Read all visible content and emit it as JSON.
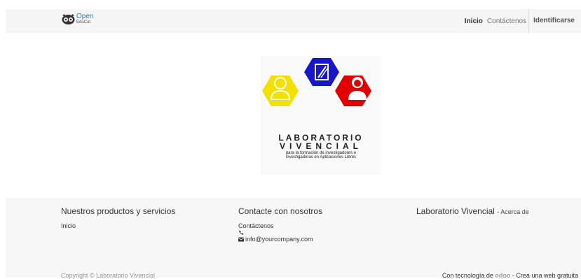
{
  "navbar": {
    "brand_line1": "Open",
    "brand_line2": "EduCat",
    "items": [
      "Inicio",
      "Contáctenos"
    ],
    "signin": "Identificarse"
  },
  "logo": {
    "title1": "LABORATORIO",
    "title2": "VIVENCIAL",
    "subtitle1": "para la formación de investigadores e",
    "subtitle2": "investigadoras en Aplicaciones Libres",
    "colors": {
      "yellow": "#f4e000",
      "blue": "#1616cc",
      "red": "#e00000"
    }
  },
  "footer": {
    "col1": {
      "title": "Nuestros productos y servicios",
      "links": [
        "Inicio"
      ]
    },
    "col2": {
      "title": "Contacte con nosotros",
      "contact_link": "Contáctenos",
      "email": "info@yourcompany.com"
    },
    "col3": {
      "title": "Laboratorio Vivencial",
      "about": "- Acerca de"
    },
    "copyright": "Copyright © Laboratorio Vivencial",
    "powered_prefix": "Con tecnología de",
    "powered_brand": "odoo",
    "powered_suffix": "- Crea una web gratuita"
  }
}
